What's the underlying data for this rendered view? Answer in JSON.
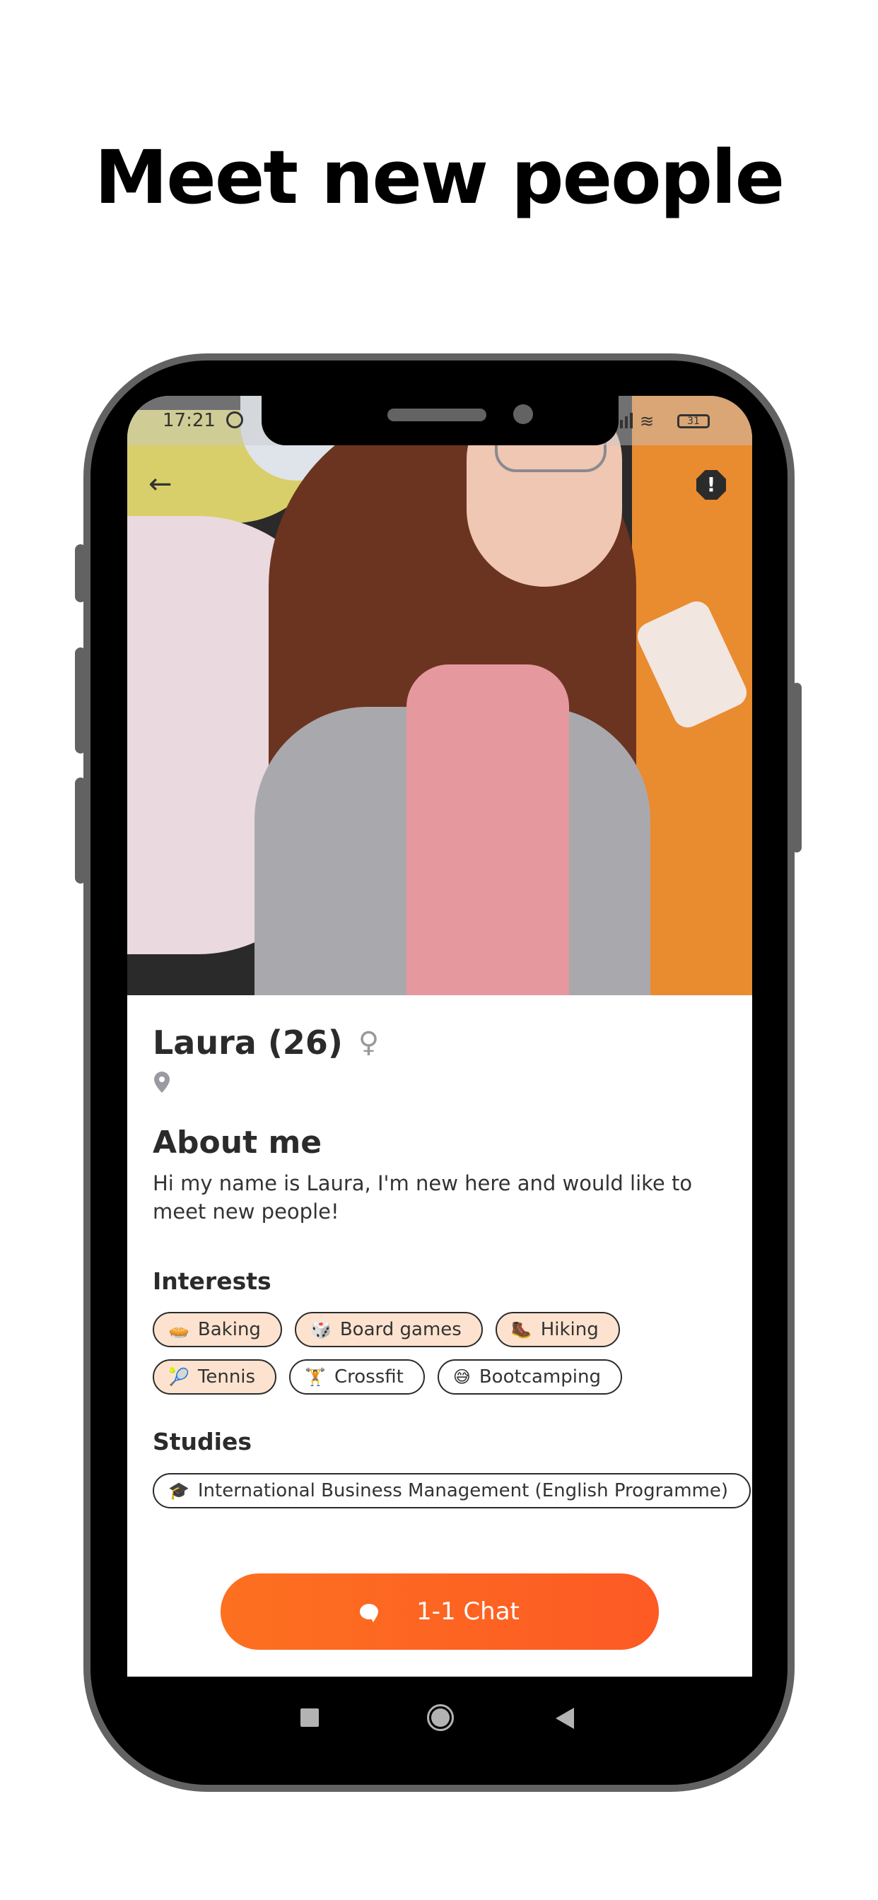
{
  "headline": "Meet new people",
  "status_bar": {
    "time": "17:21",
    "battery": "31",
    "icons": [
      "alarm-icon",
      "signal-icon",
      "wifi-icon",
      "battery-icon"
    ]
  },
  "photo_overlay": {
    "back_icon": "arrow-left-icon",
    "back_glyph": "←",
    "report_icon": "report-octagon-icon",
    "report_glyph": "!"
  },
  "profile": {
    "name": "Laura (26)",
    "gender_icon": "female-icon",
    "gender_glyph": "♀",
    "location_icon": "location-pin-icon",
    "about_title": "About me",
    "about_text": "Hi my name is Laura, I'm new here and would like to meet new people!",
    "interests_title": "Interests",
    "interests": [
      {
        "emoji": "🥧",
        "label": "Baking",
        "selected": true
      },
      {
        "emoji": "🎲",
        "label": "Board games",
        "selected": true
      },
      {
        "emoji": "🥾",
        "label": "Hiking",
        "selected": true
      },
      {
        "emoji": "🎾",
        "label": "Tennis",
        "selected": true
      },
      {
        "emoji": "🏋",
        "label": "Crossfit",
        "selected": false
      },
      {
        "emoji": "😅",
        "label": "Bootcamping",
        "selected": false
      }
    ],
    "studies_title": "Studies",
    "studies": [
      {
        "emoji": "🎓",
        "label": "International Business Management (English Programme)"
      }
    ]
  },
  "chat_button": {
    "label": "1-1 Chat",
    "icon": "chat-bubble-icon"
  },
  "colors": {
    "accent_start": "#fd7020",
    "accent_end": "#fd5a24",
    "chip_selected_bg": "#fde3cf",
    "text": "#2b2b2b",
    "phone_frame": "#626262"
  },
  "nav_bar": {
    "icons": [
      "recent-apps-icon",
      "home-icon",
      "back-icon"
    ]
  }
}
